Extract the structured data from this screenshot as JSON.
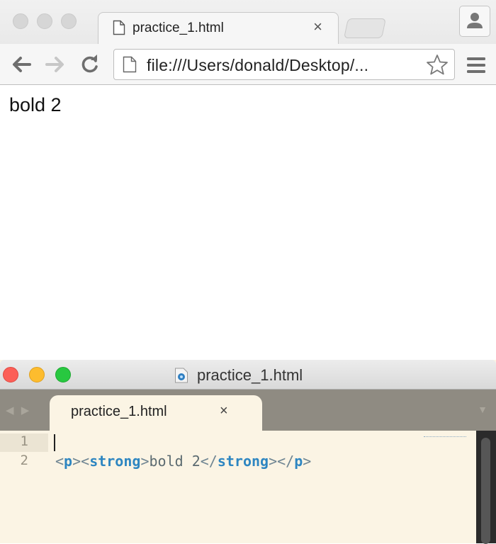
{
  "browser": {
    "tab": {
      "title": "practice_1.html",
      "close_label": "×"
    },
    "address_bar": {
      "url": "file:///Users/donald/Desktop/..."
    },
    "page": {
      "bold_text": "bold 2"
    }
  },
  "editor": {
    "window_title": "practice_1.html",
    "tab": {
      "title": "practice_1.html",
      "close_label": "×"
    },
    "nav_arrows": "◀ ▶",
    "dropdown": "▼",
    "gutter": [
      "1",
      "2"
    ],
    "code": {
      "open_p": "<",
      "p_tag": "p",
      "close_angle_1": "><",
      "strong_tag": "strong",
      "close_angle_2": ">",
      "content": "bold 2",
      "end_open_1": "</",
      "strong_tag_end": "strong",
      "end_mid": "></",
      "p_tag_end": "p",
      "end_close": ">"
    }
  },
  "colors": {
    "editor_bg": "#fbf4e4",
    "tag": "#2e86c1",
    "close_red": "#fc5f57",
    "min_yellow": "#fdbc2e",
    "zoom_green": "#28c840"
  }
}
